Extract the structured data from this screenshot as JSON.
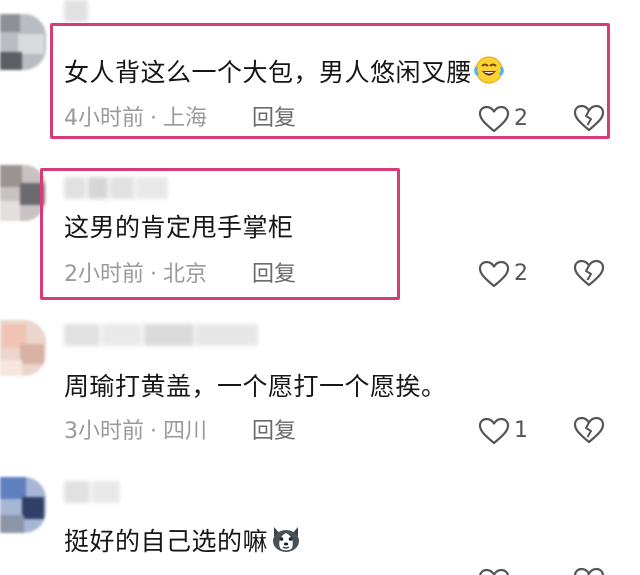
{
  "comments": [
    {
      "text": "女人背这么一个大包，男人悠闲叉腰",
      "emoji": "laughing-crying-emoji",
      "time": "4小时前",
      "location": "上海",
      "reply_label": "回复",
      "likes": "2",
      "highlighted": true
    },
    {
      "text": "这男的肯定甩手掌柜",
      "time": "2小时前",
      "location": "北京",
      "reply_label": "回复",
      "likes": "2",
      "highlighted": true
    },
    {
      "text": "周瑜打黄盖，一个愿打一个愿挨。",
      "time": "3小时前",
      "location": "四川",
      "reply_label": "回复",
      "likes": "1",
      "highlighted": false
    },
    {
      "text": "挺好的自己选的嘛",
      "emoji": "husky-dog-emoji",
      "highlighted": false
    }
  ],
  "meta_separator": "·",
  "colors": {
    "highlight_border": "#d63c78",
    "text": "#161616",
    "meta": "#9a9a9a",
    "reply": "#6b6b6b"
  },
  "icons": {
    "like": "heart-outline-icon",
    "dislike": "broken-heart-outline-icon"
  }
}
